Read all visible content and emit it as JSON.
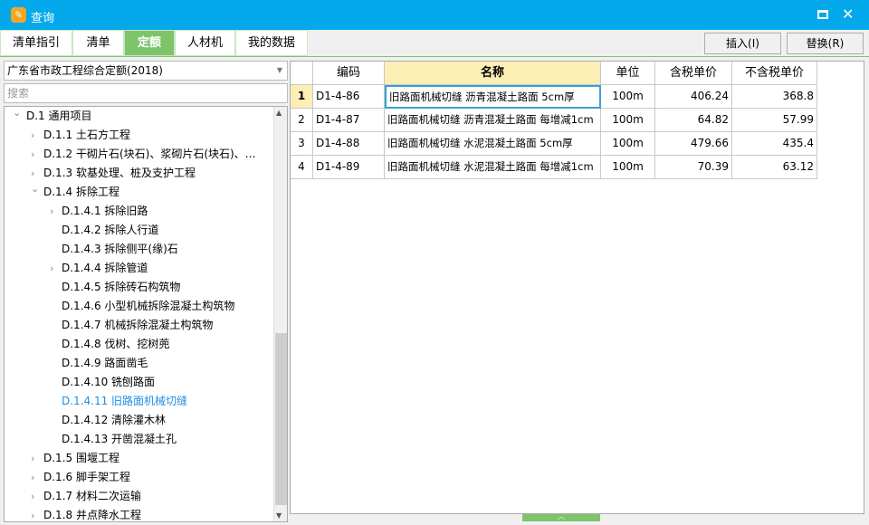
{
  "window": {
    "title": "查询",
    "app_icon": "app-logo-icon"
  },
  "tabs": [
    {
      "label": "清单指引"
    },
    {
      "label": "清单"
    },
    {
      "label": "定额",
      "active": true
    },
    {
      "label": "人材机"
    },
    {
      "label": "我的数据"
    }
  ],
  "toolbar": {
    "insert_label": "插入(I)",
    "replace_label": "替换(R)"
  },
  "library": {
    "selected": "广东省市政工程综合定额(2018)"
  },
  "search": {
    "placeholder": "搜索"
  },
  "tree": [
    {
      "label": "D.1 通用项目",
      "level": 0,
      "arrow": "down"
    },
    {
      "label": "D.1.1 土石方工程",
      "level": 1,
      "arrow": "right"
    },
    {
      "label": "D.1.2 干砌片石(块石)、浆砌片石(块石)、…",
      "level": 1,
      "arrow": "right"
    },
    {
      "label": "D.1.3 软基处理、桩及支护工程",
      "level": 1,
      "arrow": "right"
    },
    {
      "label": "D.1.4 拆除工程",
      "level": 1,
      "arrow": "down"
    },
    {
      "label": "D.1.4.1 拆除旧路",
      "level": 2,
      "arrow": "right"
    },
    {
      "label": "D.1.4.2 拆除人行道",
      "level": 2
    },
    {
      "label": "D.1.4.3 拆除侧平(缘)石",
      "level": 2
    },
    {
      "label": "D.1.4.4 拆除管道",
      "level": 2,
      "arrow": "right"
    },
    {
      "label": "D.1.4.5 拆除砖石构筑物",
      "level": 2
    },
    {
      "label": "D.1.4.6 小型机械拆除混凝土构筑物",
      "level": 2
    },
    {
      "label": "D.1.4.7 机械拆除混凝土构筑物",
      "level": 2
    },
    {
      "label": "D.1.4.8 伐树、挖树蔸",
      "level": 2
    },
    {
      "label": "D.1.4.9 路面凿毛",
      "level": 2
    },
    {
      "label": "D.1.4.10 铣刨路面",
      "level": 2
    },
    {
      "label": "D.1.4.11 旧路面机械切缝",
      "level": 2,
      "selected": true
    },
    {
      "label": "D.1.4.12 清除灌木林",
      "level": 2
    },
    {
      "label": "D.1.4.13 开凿混凝土孔",
      "level": 2
    },
    {
      "label": "D.1.5 围堰工程",
      "level": 1,
      "arrow": "right"
    },
    {
      "label": "D.1.6 脚手架工程",
      "level": 1,
      "arrow": "right"
    },
    {
      "label": "D.1.7 材料二次运输",
      "level": 1,
      "arrow": "right"
    },
    {
      "label": "D.1.8 井点降水工程",
      "level": 1,
      "arrow": "right"
    }
  ],
  "table": {
    "columns": [
      "",
      "编码",
      "名称",
      "单位",
      "含税单价",
      "不含税单价"
    ],
    "rows": [
      [
        "1",
        "D1-4-86",
        "旧路面机械切缝 沥青混凝土路面 5cm厚",
        "100m",
        "406.24",
        "368.8"
      ],
      [
        "2",
        "D1-4-87",
        "旧路面机械切缝 沥青混凝土路面 每增减1cm",
        "100m",
        "64.82",
        "57.99"
      ],
      [
        "3",
        "D1-4-88",
        "旧路面机械切缝 水泥混凝土路面 5cm厚",
        "100m",
        "479.66",
        "435.4"
      ],
      [
        "4",
        "D1-4-89",
        "旧路面机械切缝 水泥混凝土路面 每增减1cm",
        "100m",
        "70.39",
        "63.12"
      ]
    ]
  },
  "colors": {
    "titlebar": "#03a9ea",
    "accent_green": "#7dc46a",
    "selected_tree": "#1e8fe6",
    "header_highlight": "#fdeeb5"
  }
}
